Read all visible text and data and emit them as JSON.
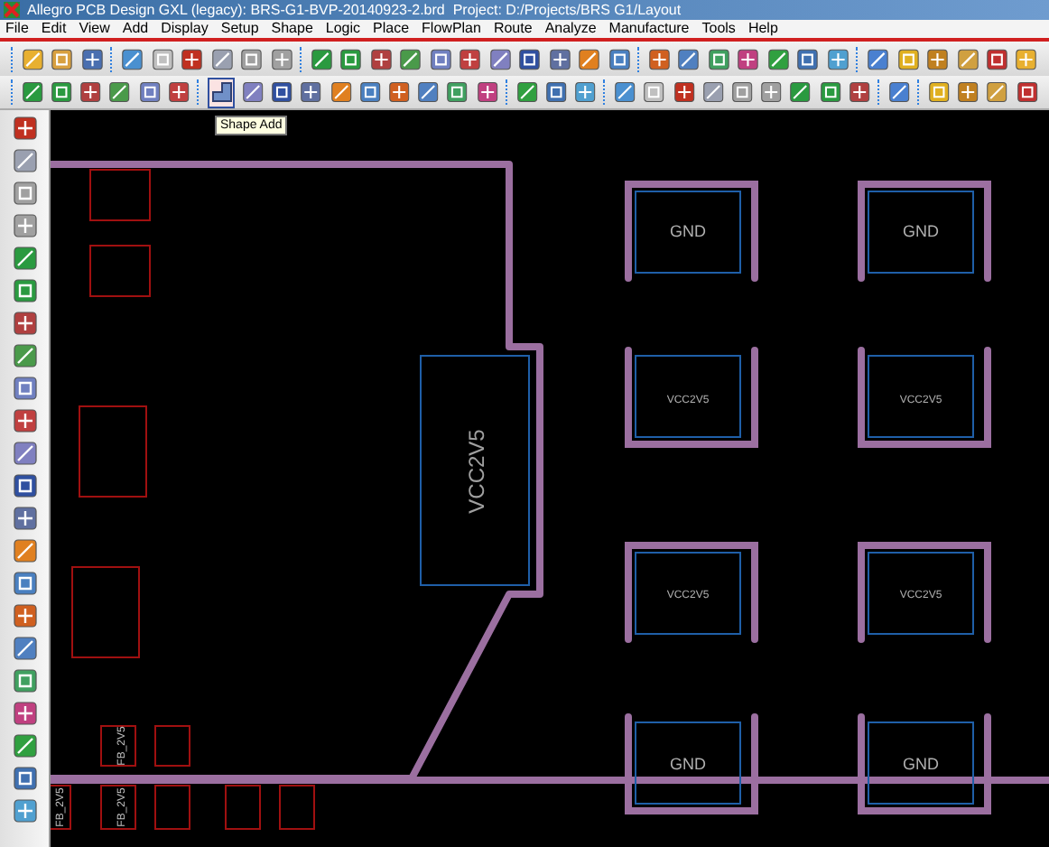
{
  "window": {
    "title": "Allegro PCB Design GXL (legacy): BRS-G1-BVP-20140923-2.brd  Project: D:/Projects/BRS G1/Layout"
  },
  "menu": [
    "File",
    "Edit",
    "View",
    "Add",
    "Display",
    "Setup",
    "Shape",
    "Logic",
    "Place",
    "FlowPlan",
    "Route",
    "Analyze",
    "Manufacture",
    "Tools",
    "Help"
  ],
  "shape_add_button": {
    "selected": true,
    "tooltip": "Shape Add"
  },
  "canvas": {
    "component": {
      "label": "VCC2V5"
    },
    "pads": [
      {
        "label": "GND",
        "kind": "large"
      },
      {
        "label": "GND",
        "kind": "large"
      },
      {
        "label": "VCC2V5",
        "kind": "small"
      },
      {
        "label": "VCC2V5",
        "kind": "small"
      },
      {
        "label": "VCC2V5",
        "kind": "small"
      },
      {
        "label": "VCC2V5",
        "kind": "small"
      },
      {
        "label": "GND",
        "kind": "large"
      },
      {
        "label": "GND",
        "kind": "large"
      }
    ],
    "footprint_labels": [
      "FB_2V5",
      "FB_2V5",
      "FB_2V5"
    ]
  }
}
